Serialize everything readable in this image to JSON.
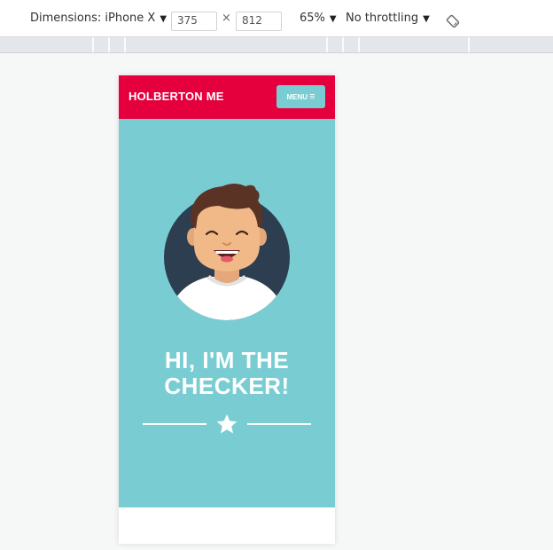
{
  "devtools": {
    "dimensions_label": "Dimensions: iPhone X",
    "width_value": "375",
    "times_symbol": "×",
    "height_value": "812",
    "zoom_label": "65%",
    "throttling_label": "No throttling",
    "caret": "▼"
  },
  "site": {
    "brand": "HOLBERTON ME",
    "menu_label": "MENU",
    "menu_icon": "≡",
    "hero_line1": "HI, I'M THE",
    "hero_line2": "CHECKER!"
  },
  "colors": {
    "header_red": "#e5003d",
    "hero_teal": "#79cdd2",
    "avatar_navy": "#2c3e50"
  }
}
